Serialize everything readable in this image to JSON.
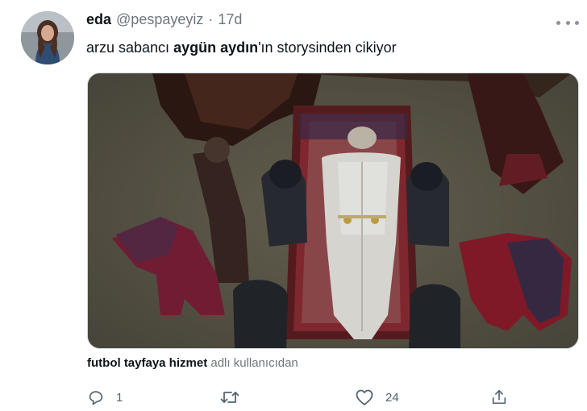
{
  "tweet": {
    "display_name": "eda",
    "handle": "@pespayeyiz",
    "separator": "·",
    "time": "17d",
    "text_start": "arzu sabancı ",
    "text_bold": "aygün aydın",
    "text_end": "'ın storysinden cikiyor"
  },
  "attribution": {
    "bold": "futbol tayfaya hizmet",
    "rest": "adlı kullanıcıdan"
  },
  "actions": {
    "reply_count": "1",
    "retweet_count": "",
    "like_count": "24"
  },
  "icons": {
    "more": "more-horizontal-icon",
    "reply": "reply-icon",
    "retweet": "retweet-icon",
    "like": "heart-icon",
    "share": "share-icon"
  }
}
